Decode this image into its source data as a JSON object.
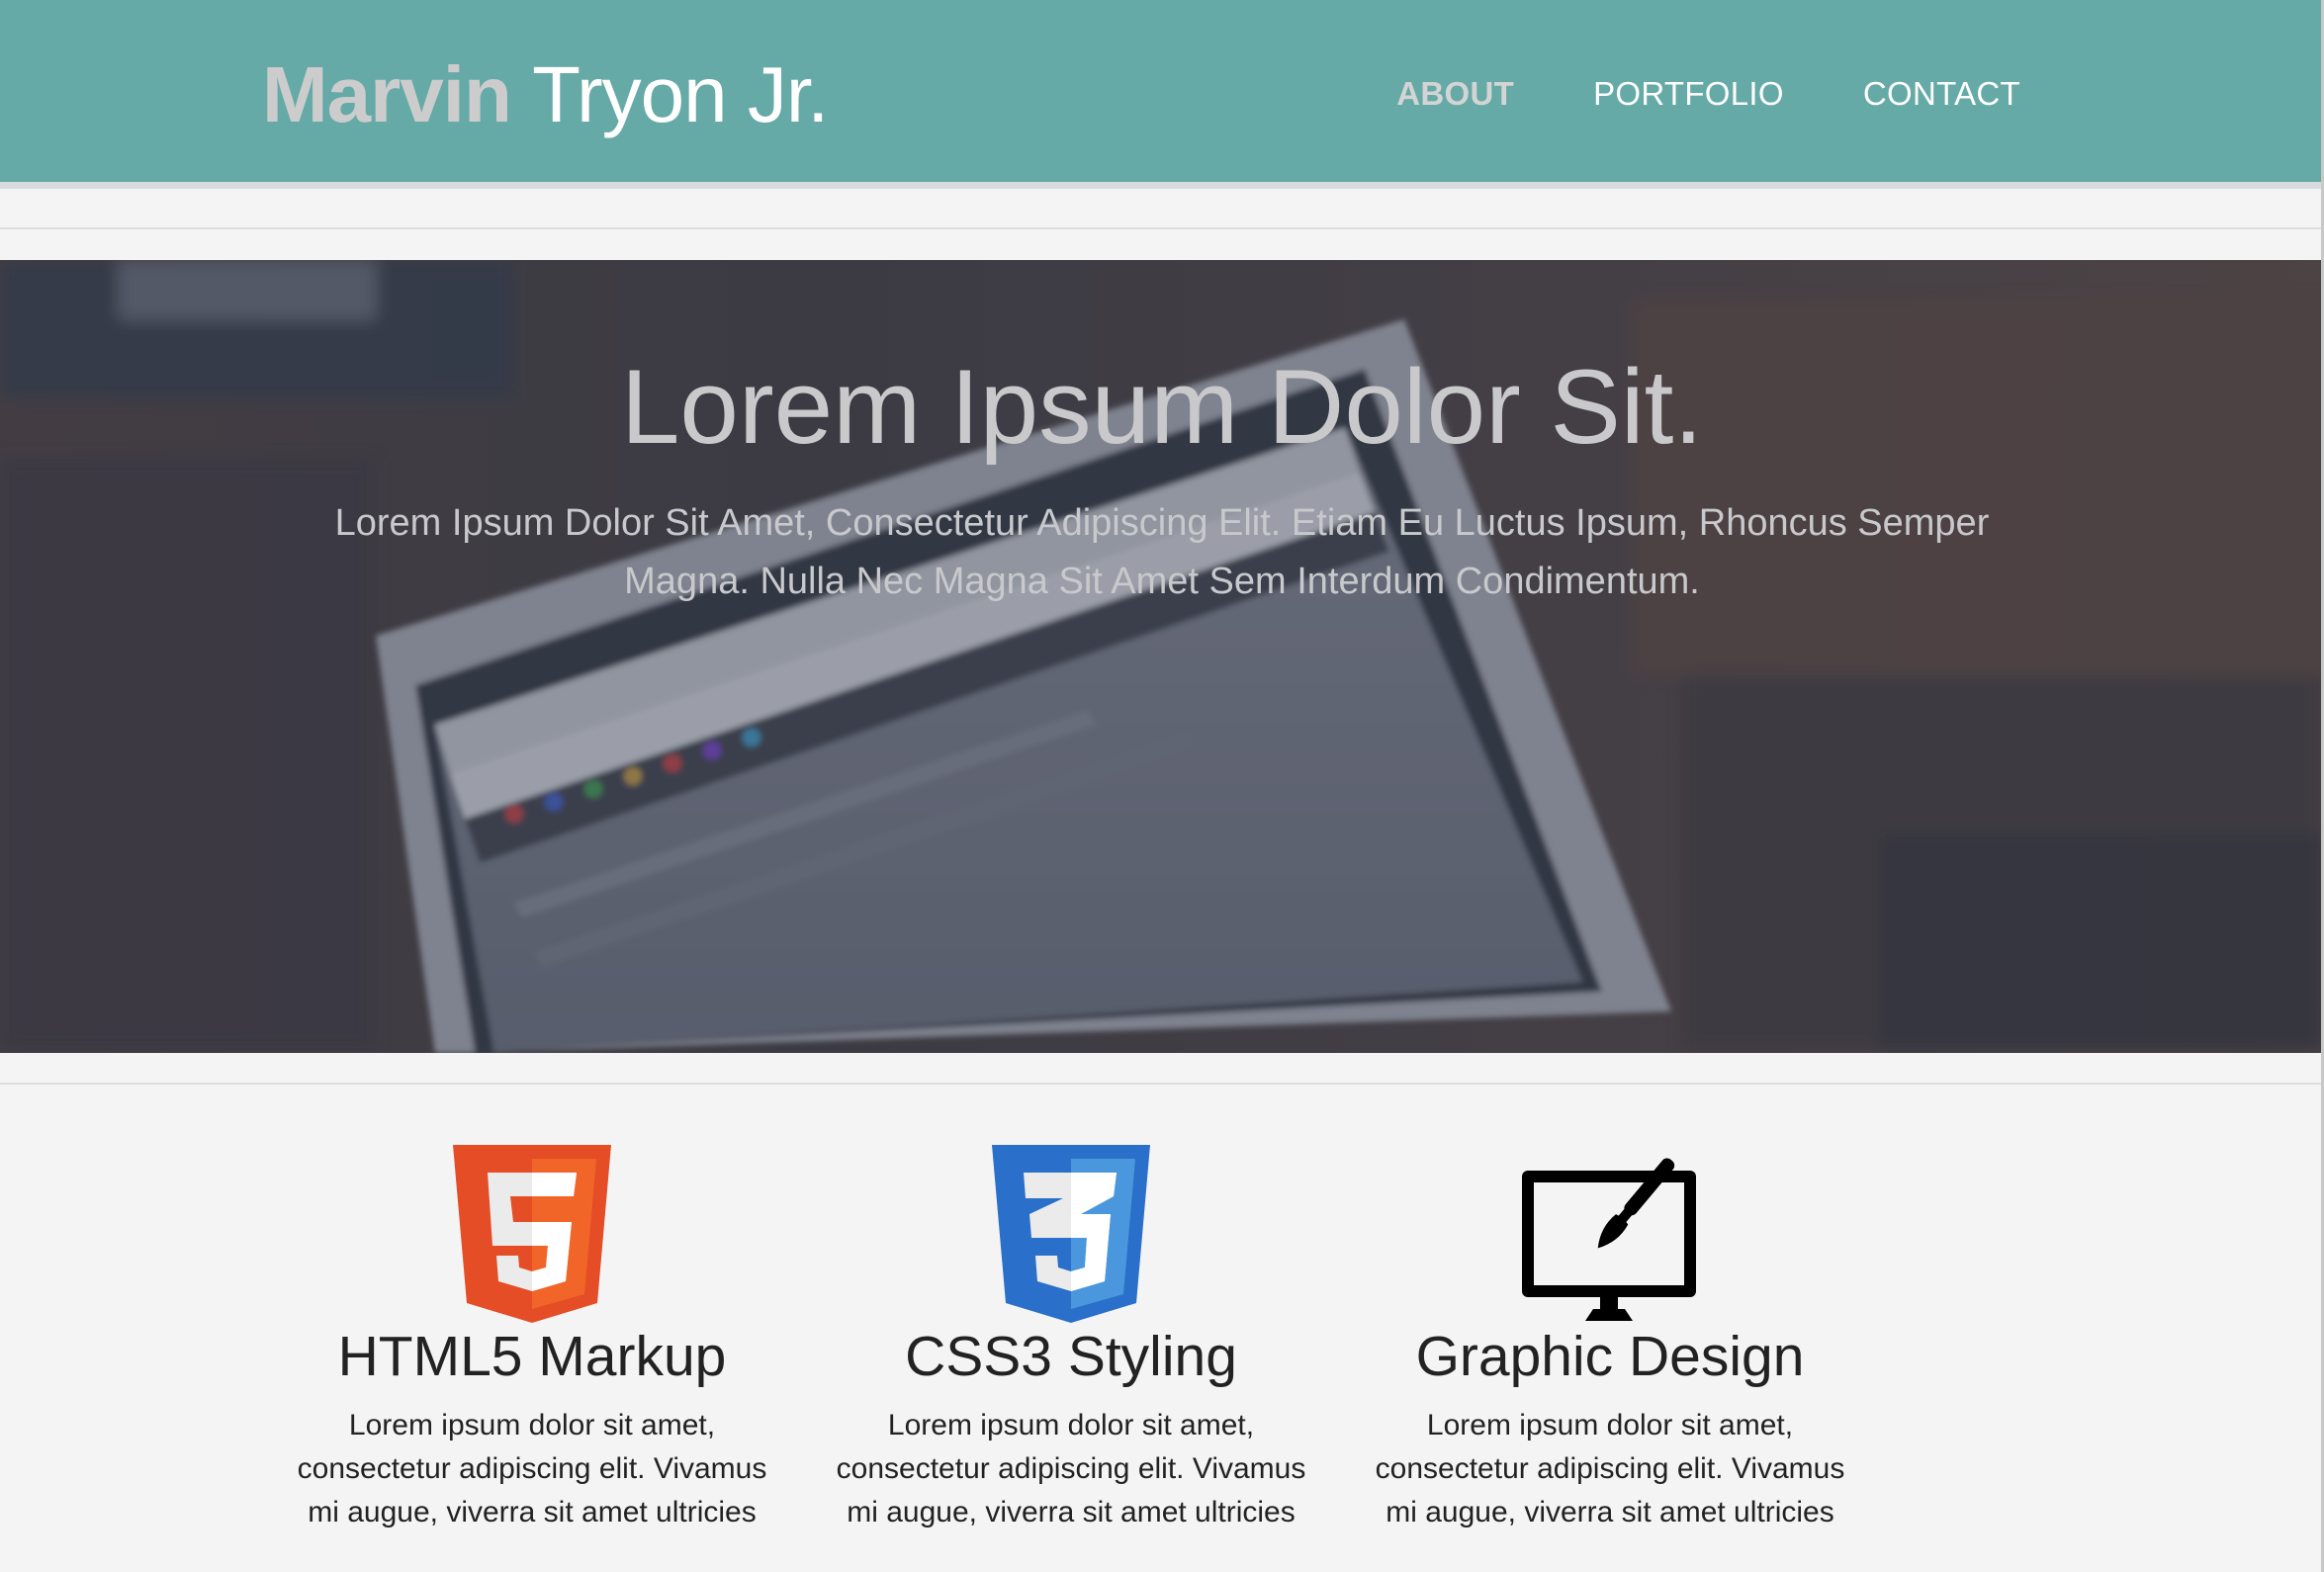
{
  "header": {
    "brand_first": "Marvin",
    "brand_last": "Tryon Jr.",
    "nav": [
      {
        "label": "ABOUT"
      },
      {
        "label": "PORTFOLIO"
      },
      {
        "label": "CONTACT"
      }
    ],
    "background_color": "#65aaa6"
  },
  "hero": {
    "title": "Lorem Ipsum Dolor Sit.",
    "text": "Lorem Ipsum Dolor Sit Amet, Consectetur Adipiscing Elit. Etiam Eu Luctus Ipsum, Rhoncus Semper Magna. Nulla Nec Magna Sit Amet Sem Interdum Condimentum."
  },
  "features": [
    {
      "icon": "html5-logo-icon",
      "title": "HTML5 Markup",
      "text": "Lorem ipsum dolor sit amet, consectetur adipiscing elit. Vivamus mi augue, viverra sit amet ultricies"
    },
    {
      "icon": "css3-logo-icon",
      "title": "CSS3 Styling",
      "text": "Lorem ipsum dolor sit amet, consectetur adipiscing elit. Vivamus mi augue, viverra sit amet ultricies"
    },
    {
      "icon": "monitor-paintbrush-icon",
      "title": "Graphic Design",
      "text": "Lorem ipsum dolor sit amet, consectetur adipiscing elit. Vivamus mi augue, viverra sit amet ultricies"
    }
  ]
}
